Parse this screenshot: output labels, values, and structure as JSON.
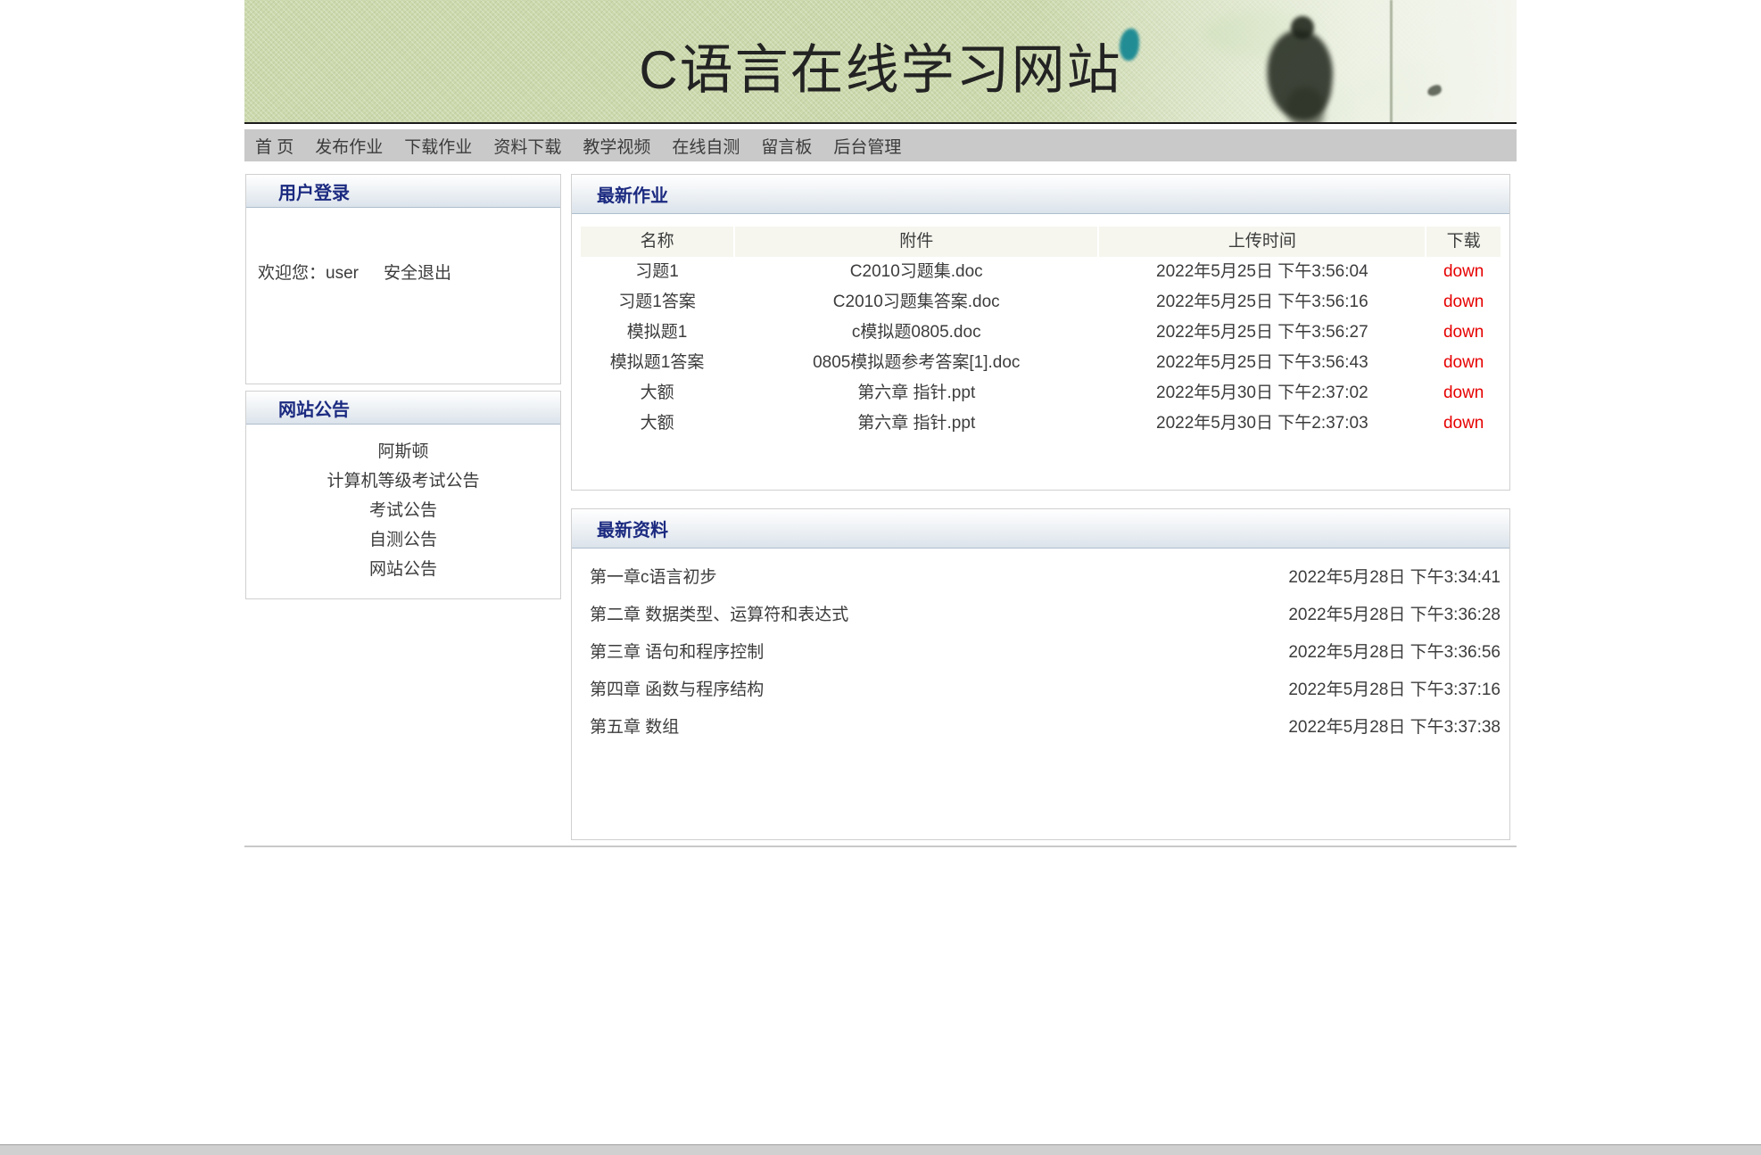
{
  "colors": {
    "accent": "#1b2a80",
    "down-red": "#e60000",
    "banner-green": "#ccd9ad",
    "nav-gray": "#c9c9c9",
    "thead-beige": "#f6f6ef",
    "box-border": "#d0d0d0",
    "body-text": "#3c3c3c"
  },
  "banner": {
    "title": "C语言在线学习网站"
  },
  "nav": {
    "items": [
      "首 页",
      "发布作业",
      "下载作业",
      "资料下载",
      "教学视频",
      "在线自测",
      "留言板",
      "后台管理"
    ]
  },
  "sidebar": {
    "login": {
      "title": "用户登录",
      "welcome_prefix": "欢迎您：",
      "username": "user",
      "logout_label": "安全退出"
    },
    "notice": {
      "title": "网站公告",
      "items": [
        "阿斯顿",
        "计算机等级考试公告",
        "考试公告",
        "自测公告",
        "网站公告"
      ]
    }
  },
  "homework": {
    "title": "最新作业",
    "columns": [
      "名称",
      "附件",
      "上传时间",
      "下载"
    ],
    "download_label": "down",
    "rows": [
      {
        "name": "习题1",
        "file": "C2010习题集.doc",
        "time": "2022年5月25日 下午3:56:04"
      },
      {
        "name": "习题1答案",
        "file": "C2010习题集答案.doc",
        "time": "2022年5月25日 下午3:56:16"
      },
      {
        "name": "模拟题1",
        "file": "c模拟题0805.doc",
        "time": "2022年5月25日 下午3:56:27"
      },
      {
        "name": "模拟题1答案",
        "file": "0805模拟题参考答案[1].doc",
        "time": "2022年5月25日 下午3:56:43"
      },
      {
        "name": "大额",
        "file": "第六章 指针.ppt",
        "time": "2022年5月30日 下午2:37:02"
      },
      {
        "name": "大额",
        "file": "第六章 指针.ppt",
        "time": "2022年5月30日 下午2:37:03"
      }
    ]
  },
  "materials": {
    "title": "最新资料",
    "rows": [
      {
        "name": "第一章c语言初步",
        "time": "2022年5月28日 下午3:34:41"
      },
      {
        "name": "第二章 数据类型、运算符和表达式",
        "time": "2022年5月28日 下午3:36:28"
      },
      {
        "name": "第三章 语句和程序控制",
        "time": "2022年5月28日 下午3:36:56"
      },
      {
        "name": "第四章 函数与程序结构",
        "time": "2022年5月28日 下午3:37:16"
      },
      {
        "name": "第五章 数组",
        "time": "2022年5月28日 下午3:37:38"
      }
    ]
  }
}
